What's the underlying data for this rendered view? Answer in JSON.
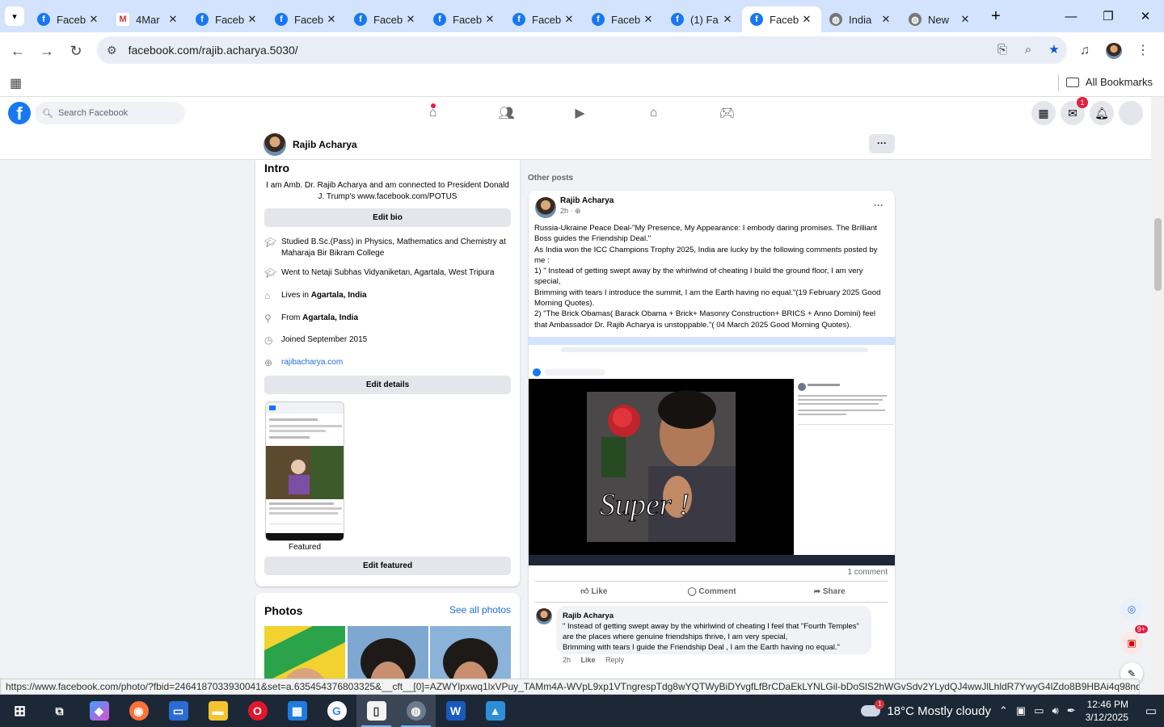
{
  "browser": {
    "tabs": [
      {
        "label": "Faceb",
        "icon": "facebook-icon",
        "active": false
      },
      {
        "label": "4Mar",
        "icon": "gmail-icon",
        "active": false
      },
      {
        "label": "Faceb",
        "icon": "facebook-icon",
        "active": false
      },
      {
        "label": "Faceb",
        "icon": "facebook-icon",
        "active": false
      },
      {
        "label": "Faceb",
        "icon": "facebook-icon",
        "active": false
      },
      {
        "label": "Faceb",
        "icon": "facebook-icon",
        "active": false
      },
      {
        "label": "Faceb",
        "icon": "facebook-icon",
        "active": false
      },
      {
        "label": "Faceb",
        "icon": "facebook-icon",
        "active": false
      },
      {
        "label": "(1) Fa",
        "icon": "facebook-icon",
        "active": false
      },
      {
        "label": "Faceb",
        "icon": "facebook-icon",
        "active": true
      },
      {
        "label": "India",
        "icon": "globe-icon",
        "active": false
      },
      {
        "label": "New",
        "icon": "globe-icon",
        "active": false
      }
    ],
    "url": "facebook.com/rajib.acharya.5030/",
    "bookmarks_label": "All Bookmarks",
    "status_url": "https://www.facebook.com/photo/?fbid=2464187033930041&set=a.635454376803325&__cft__[0]=AZWYlpxwq1lxVPuy_TAMm4A-WVpL9xp1VTngrespTdg8wYQTWyBiDYvgfLfBrCDaEkLYNLGil-bDoSlS2hWGvSdv2YLydQJ4wwJlLhldR7YwyG4lZdo8B9HBAi4q98ndymT..."
  },
  "facebook": {
    "search_placeholder": "Search Facebook",
    "messenger_badge": "1",
    "profile_name": "Rajib Acharya",
    "intro": {
      "title": "Intro",
      "bio_line1": "I am Amb. Dr. Rajib Acharya and am connected to President Donald",
      "bio_line2": "J. Trump's www.facebook.com/POTUS",
      "edit_bio": "Edit bio",
      "studied": "Studied B.Sc.(Pass) in Physics, Mathematics and Chemistry at Maharaja Bir Bikram College",
      "went_to": "Went to Netaji Subhas Vidyaniketan, Agartala, West Tripura",
      "lives_prefix": "Lives in ",
      "lives_place": "Agartala, India",
      "from_prefix": "From ",
      "from_place": "Agartala, India",
      "joined": "Joined September 2015",
      "website": "rajibacharya.com",
      "edit_details": "Edit details",
      "featured_label": "Featured",
      "edit_featured": "Edit featured"
    },
    "photos": {
      "title": "Photos",
      "see_all": "See all photos"
    },
    "other_posts_label": "Other posts",
    "post": {
      "author": "Rajib Acharya",
      "time": "2h",
      "text": [
        "Russia-Ukraine Peace Deal-\"My Presence, My Appearance: I embody daring promises. The Brilliant Boss guides the Friendship Deal.\"",
        "As India won the ICC Champions Trophy 2025, India are lucky by the following comments posted by me :",
        "1) \" Instead of getting swept away by the whirlwind of cheating I build the ground floor, I am very special,",
        "Brimming with tears I introduce the summit, I am the Earth having no equal.\"(19 February 2025 Good Morning Quotes).",
        "2) \"The Brick Obamas( Barack Obama + Brick+ Masonry Construction+ BRICS + Anno Domini) feel that Ambassador Dr. Rajib Acharya is unstoppable.\"( 04 March 2025 Good Morning Quotes)."
      ],
      "image_caption": "Super !",
      "comments_count": "1 comment",
      "like": "Like",
      "comment": "Comment",
      "share": "Share",
      "top_comment": {
        "author": "Rajib Acharya",
        "text1": "\" Instead of getting swept away by the whirlwind of cheating I feel that \"Fourth Temples\" are the places where genuine friendships thrive, I am very special,",
        "text2": "Brimming with tears I guide the Friendship Deal , I am the Earth having no equal.\"",
        "time": "2h",
        "like": "Like",
        "reply": "Reply"
      }
    },
    "floating_badge": "9+"
  },
  "taskbar": {
    "weather_badge": "1",
    "weather": "18°C  Mostly cloudy",
    "time": "12:46 PM",
    "date": "3/12/2025"
  }
}
